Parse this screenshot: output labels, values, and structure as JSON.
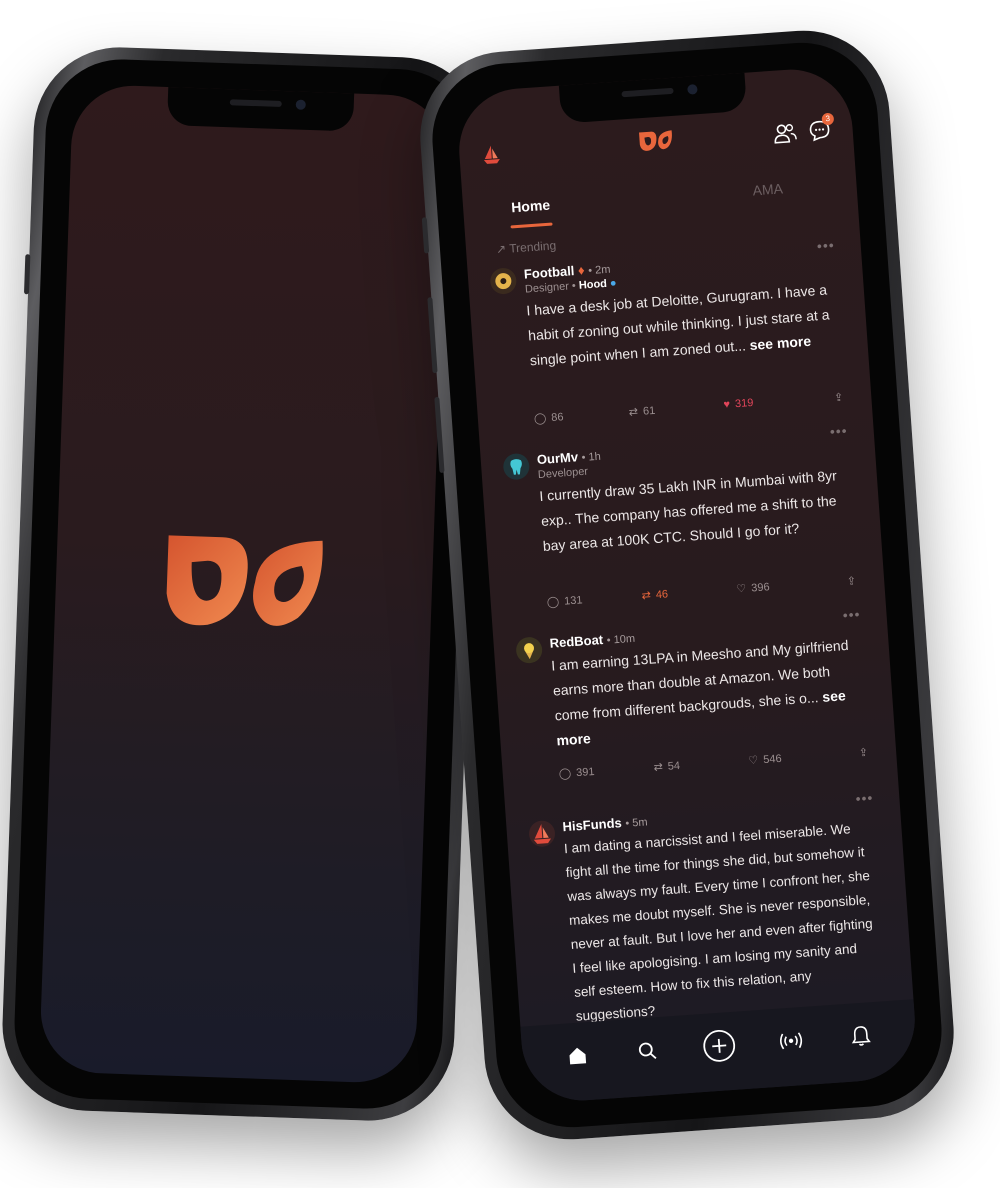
{
  "splash": {
    "logo": "glimmer-logo",
    "accent": "#e8663c"
  },
  "feed": {
    "header": {
      "left_icon": "boat-avatar-icon",
      "logo": "glimmer-logo",
      "people_icon": "people-icon",
      "chat_icon": "chat-icon",
      "chat_badge": "3"
    },
    "tabs": [
      {
        "label": "Home",
        "active": true
      },
      {
        "label": "AMA",
        "active": false
      }
    ],
    "section_label": "Trending",
    "posts": [
      {
        "author": "Football",
        "time": "2m",
        "role": "Designer",
        "community": "Hood",
        "body": "I have a desk job at Deloitte, Gurugram. I have a habit of zoning out while thinking. I just stare at a single point when I am zoned out...",
        "see_more": "see more",
        "comments": "86",
        "reposts": "61",
        "likes": "319"
      },
      {
        "author": "OurMv",
        "time": "1h",
        "role": "Developer",
        "body": "I currently draw 35 Lakh INR in Mumbai with 8yr exp.. The company has offered me a shift to the bay area at 100K CTC. Should I go for it?",
        "comments": "131",
        "reposts": "46",
        "likes": "396"
      },
      {
        "author": "RedBoat",
        "time": "10m",
        "body": "I am earning 13LPA in Meesho and My girlfriend earns more than double at Amazon. We both come from different backgrouds, she is o...",
        "see_more": "see more",
        "comments": "391",
        "reposts": "54",
        "likes": "546"
      },
      {
        "author": "HisFunds",
        "time": "5m",
        "body": "I am dating a narcissist and I feel miserable. We fight all the time for things she did, but somehow it was always my fault. Every time I confront her, she makes me doubt myself. She is never responsible, never at fault. But I love her and even after fighting I feel like apologising. I am losing my sanity and self esteem. How to fix this relation, any suggestions?"
      }
    ],
    "bottom_nav": [
      "home-icon",
      "search-icon",
      "add-post-icon",
      "live-icon",
      "bell-icon"
    ]
  }
}
